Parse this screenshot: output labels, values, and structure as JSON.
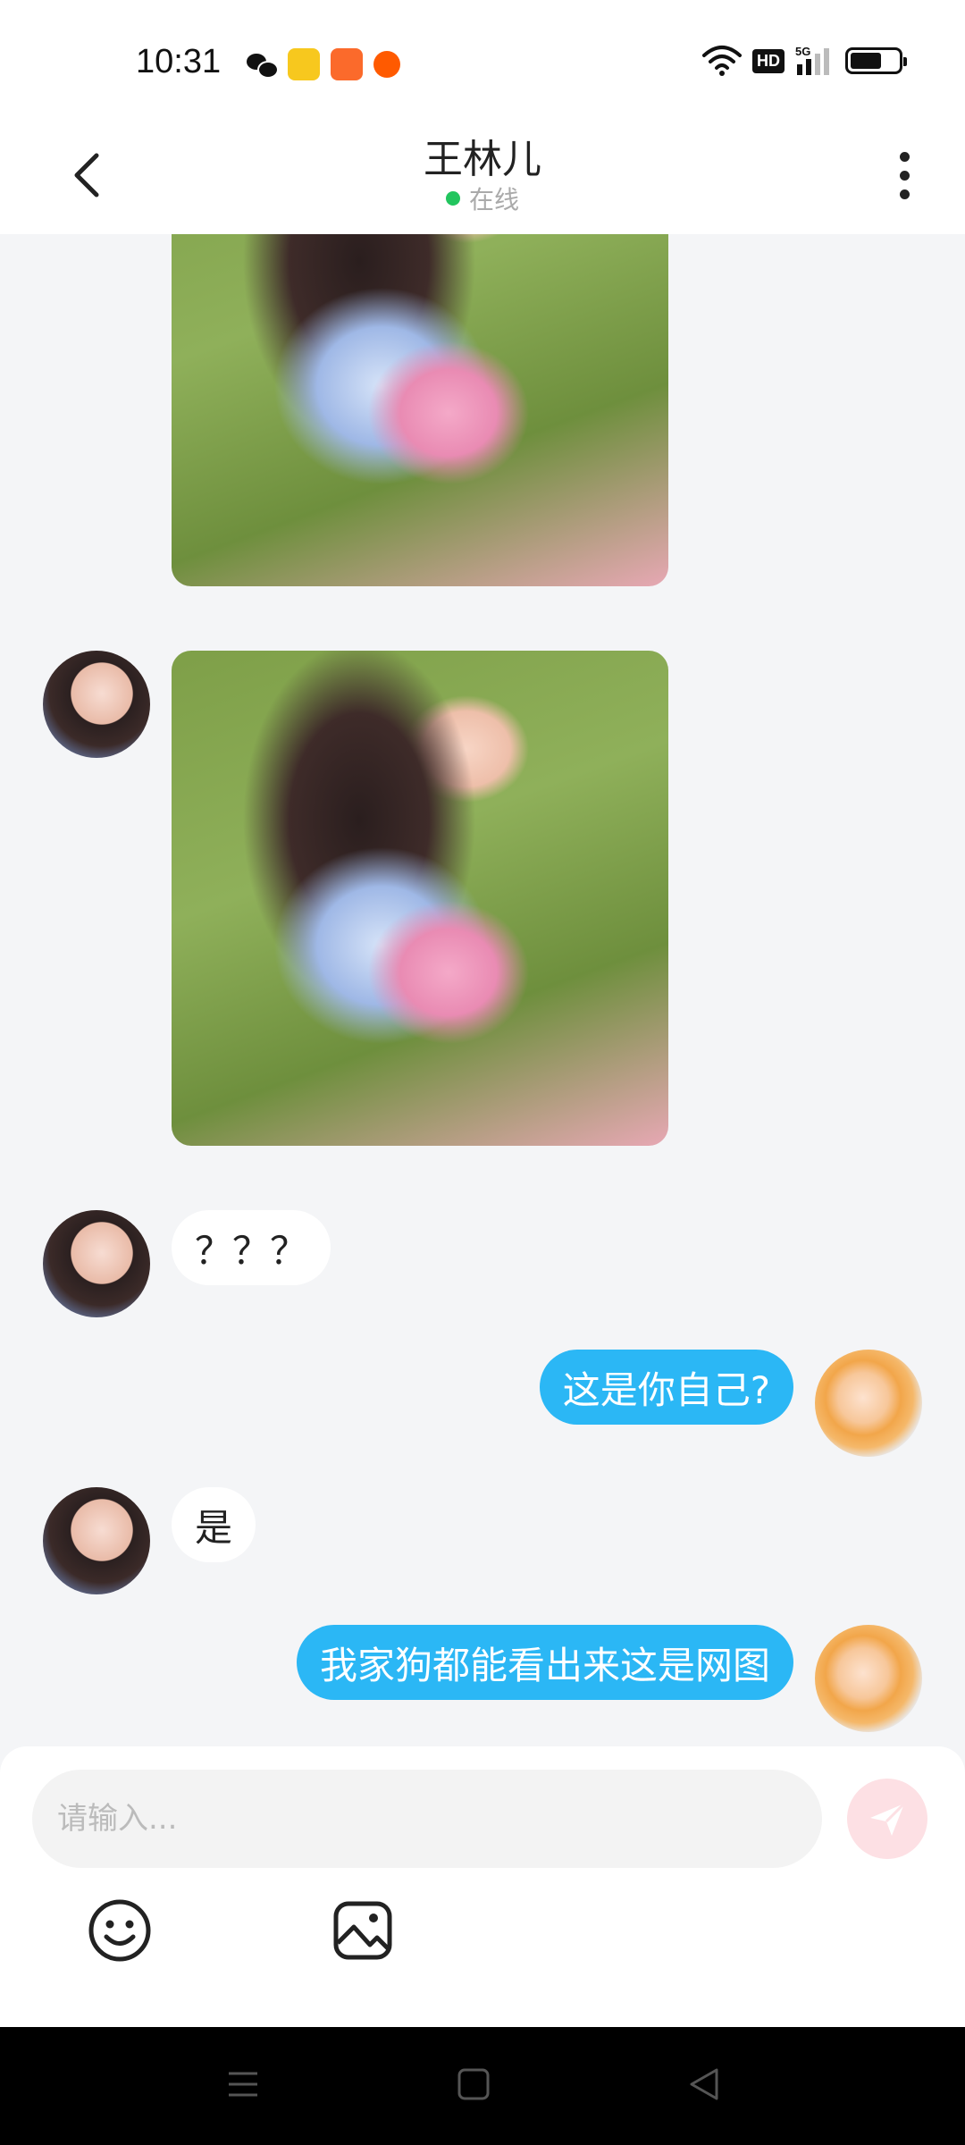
{
  "status_bar": {
    "time": "10:31",
    "notification_icons": [
      "wechat-icon",
      "seven-app-icon",
      "kuaishou-icon",
      "taobao-icon"
    ],
    "hd_label": "HD",
    "network_label": "5G",
    "battery_level": 0.65
  },
  "header": {
    "title": "王林儿",
    "status": "在线",
    "status_color": "#22c55e"
  },
  "messages": [
    {
      "side": "in",
      "type": "image",
      "description_icon": "photo"
    },
    {
      "side": "in",
      "type": "image",
      "description_icon": "photo"
    },
    {
      "side": "in",
      "type": "text",
      "text": "？？？"
    },
    {
      "side": "out",
      "type": "text",
      "text": "这是你自己?"
    },
    {
      "side": "in",
      "type": "text",
      "text": "是"
    },
    {
      "side": "out",
      "type": "text",
      "text": "我家狗都能看出来这是网图"
    }
  ],
  "input": {
    "placeholder": "请输入..."
  },
  "colors": {
    "outgoing_bubble": "#2bb7f5",
    "incoming_bubble": "#ffffff",
    "send_button": "#fde0e4",
    "background": "#f4f5f7"
  },
  "toolbar": {
    "icons": [
      "emoji-icon",
      "image-icon"
    ]
  },
  "nav_bar": {
    "icons": [
      "menu-icon",
      "home-icon",
      "back-icon"
    ]
  }
}
